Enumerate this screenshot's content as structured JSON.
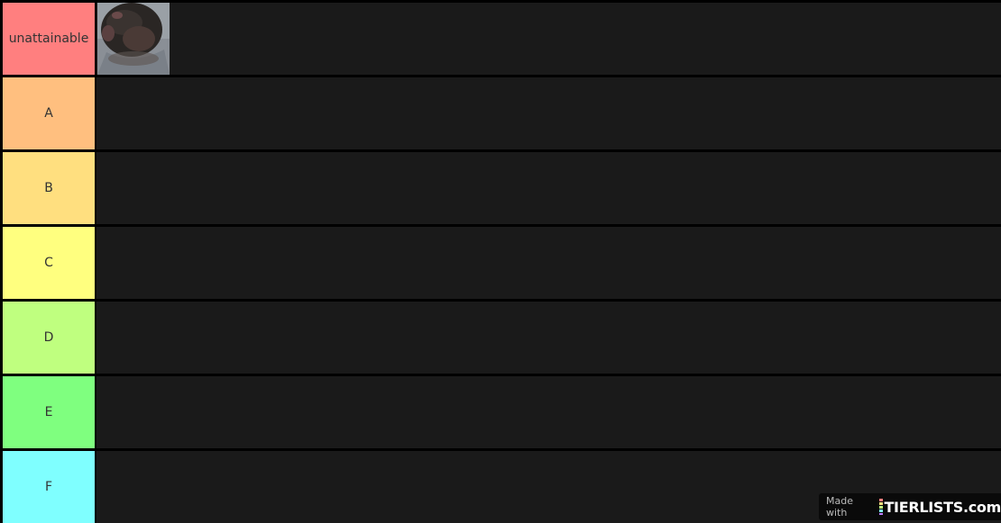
{
  "tiers": [
    {
      "label": "unattainable",
      "color": "#ff7f7f"
    },
    {
      "label": "A",
      "color": "#ffbf7f"
    },
    {
      "label": "B",
      "color": "#ffdf7f"
    },
    {
      "label": "C",
      "color": "#ffff7f"
    },
    {
      "label": "D",
      "color": "#bfff7f"
    },
    {
      "label": "E",
      "color": "#7fff7f"
    },
    {
      "label": "F",
      "color": "#7fffff"
    }
  ],
  "row_background": "#1a1a1a",
  "watermark": {
    "prefix": "Made with",
    "brand": "TIERLISTS.com"
  }
}
